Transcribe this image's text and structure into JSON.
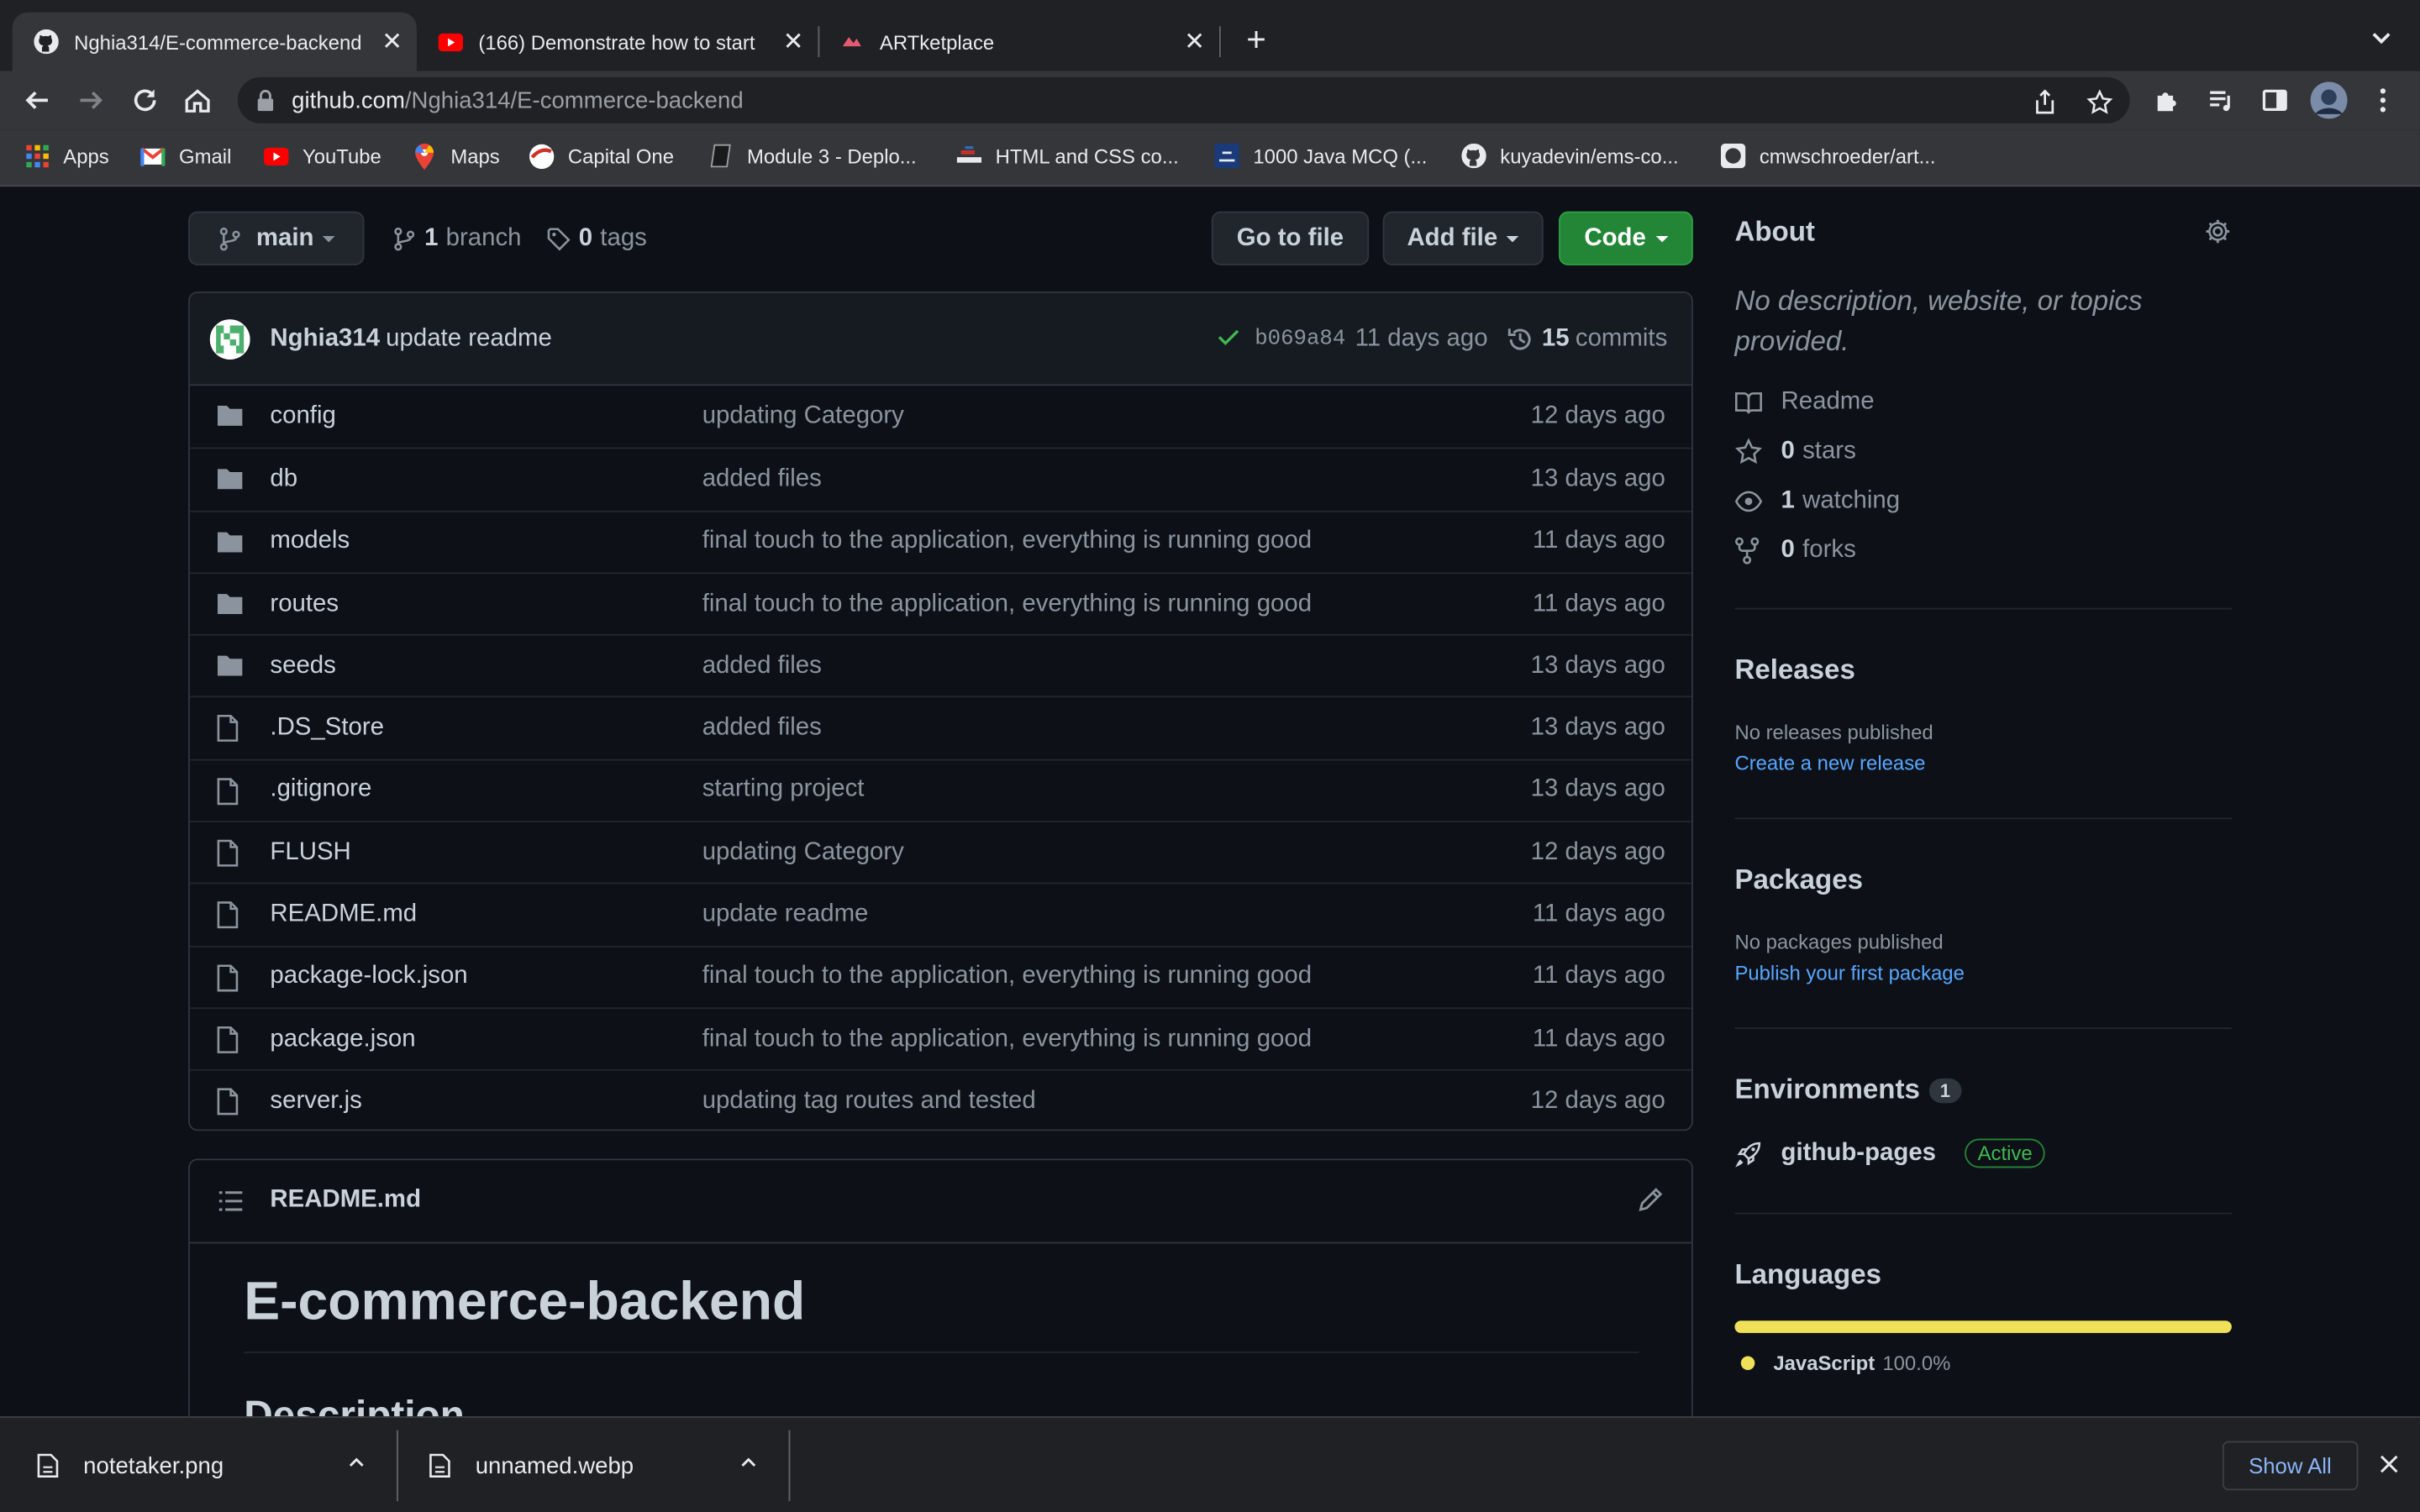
{
  "browser": {
    "tabs": [
      {
        "title": "Nghia314/E-commerce-backend",
        "icon": "github-icon"
      },
      {
        "title": "(166) Demonstrate how to start",
        "icon": "youtube-icon"
      },
      {
        "title": "ARTketplace",
        "icon": "artketplace-icon"
      }
    ],
    "url_host": "github.com",
    "url_path": "/Nghia314/E-commerce-backend",
    "bookmarks": [
      {
        "label": "Apps",
        "icon": "apps-grid-icon"
      },
      {
        "label": "Gmail",
        "icon": "gmail-icon"
      },
      {
        "label": "YouTube",
        "icon": "youtube-icon"
      },
      {
        "label": "Maps",
        "icon": "maps-icon"
      },
      {
        "label": "Capital One",
        "icon": "capital-one-icon"
      },
      {
        "label": "Module 3 - Deplo...",
        "icon": "module-icon"
      },
      {
        "label": "HTML and CSS co...",
        "icon": "html-css-icon"
      },
      {
        "label": "1000 Java MCQ (...",
        "icon": "java-mcq-icon"
      },
      {
        "label": "kuyadevin/ems-co...",
        "icon": "github-icon"
      },
      {
        "label": "cmwschroeder/art...",
        "icon": "github-icon"
      }
    ]
  },
  "repo": {
    "branch": "main",
    "branches_count": "1",
    "branches_label": "branch",
    "tags_count": "0",
    "tags_label": "tags",
    "go_to_file": "Go to file",
    "add_file": "Add file",
    "code": "Code",
    "latest_commit": {
      "author": "Nghia314",
      "message": "update readme",
      "sha": "b069a84",
      "ago": "11 days ago",
      "commits_count": "15",
      "commits_label": "commits"
    },
    "files": [
      {
        "type": "dir",
        "name": "config",
        "message": "updating Category",
        "age": "12 days ago"
      },
      {
        "type": "dir",
        "name": "db",
        "message": "added files",
        "age": "13 days ago"
      },
      {
        "type": "dir",
        "name": "models",
        "message": "final touch to the application, everything is running good",
        "age": "11 days ago"
      },
      {
        "type": "dir",
        "name": "routes",
        "message": "final touch to the application, everything is running good",
        "age": "11 days ago"
      },
      {
        "type": "dir",
        "name": "seeds",
        "message": "added files",
        "age": "13 days ago"
      },
      {
        "type": "file",
        "name": ".DS_Store",
        "message": "added files",
        "age": "13 days ago"
      },
      {
        "type": "file",
        "name": ".gitignore",
        "message": "starting project",
        "age": "13 days ago"
      },
      {
        "type": "file",
        "name": "FLUSH",
        "message": "updating Category",
        "age": "12 days ago"
      },
      {
        "type": "file",
        "name": "README.md",
        "message": "update readme",
        "age": "11 days ago"
      },
      {
        "type": "file",
        "name": "package-lock.json",
        "message": "final touch to the application, everything is running good",
        "age": "11 days ago"
      },
      {
        "type": "file",
        "name": "package.json",
        "message": "final touch to the application, everything is running good",
        "age": "11 days ago"
      },
      {
        "type": "file",
        "name": "server.js",
        "message": "updating tag routes and tested",
        "age": "12 days ago"
      }
    ],
    "readme": {
      "filename": "README.md",
      "h1": "E-commerce-backend",
      "h2": "Description"
    }
  },
  "sidebar": {
    "about_title": "About",
    "description": "No description, website, or topics provided.",
    "readme": "Readme",
    "stars_count": "0",
    "stars_label": "stars",
    "watching_count": "1",
    "watching_label": "watching",
    "forks_count": "0",
    "forks_label": "forks",
    "releases_title": "Releases",
    "releases_none": "No releases published",
    "releases_link": "Create a new release",
    "packages_title": "Packages",
    "packages_none": "No packages published",
    "packages_link": "Publish your first package",
    "environments_title": "Environments",
    "environments_count": "1",
    "environment_name": "github-pages",
    "environment_status": "Active",
    "languages_title": "Languages",
    "language_name": "JavaScript",
    "language_percent": "100.0%",
    "language_color": "#f1e05a"
  },
  "downloads": {
    "items": [
      "notetaker.png",
      "unnamed.webp"
    ],
    "show_all": "Show All"
  }
}
